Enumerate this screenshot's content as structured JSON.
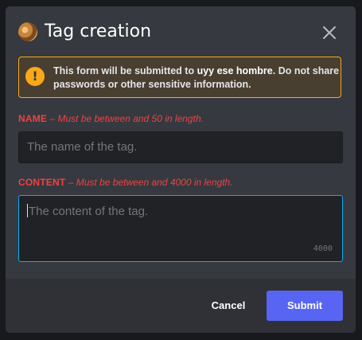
{
  "modal": {
    "title": "Tag creation"
  },
  "warning": {
    "text_prefix": "This form will be submitted to ",
    "server_name": "uyy ese hombre",
    "text_suffix": ". Do not share passwords or other sensitive information.",
    "icon": "exclamation-icon",
    "icon_glyph": "!"
  },
  "fields": {
    "name": {
      "label": "NAME",
      "hint": " – Must be between and 50 in length.",
      "placeholder": "The name of the tag.",
      "value": ""
    },
    "content": {
      "label": "CONTENT",
      "hint": " – Must be between and 4000 in length.",
      "placeholder": "The content of the tag.",
      "value": "",
      "remaining": "4000"
    }
  },
  "footer": {
    "cancel_label": "Cancel",
    "submit_label": "Submit"
  },
  "colors": {
    "accent": "#5865f2",
    "warning": "#faa81a",
    "error": "#ed4245",
    "focus": "#00b0f4"
  }
}
